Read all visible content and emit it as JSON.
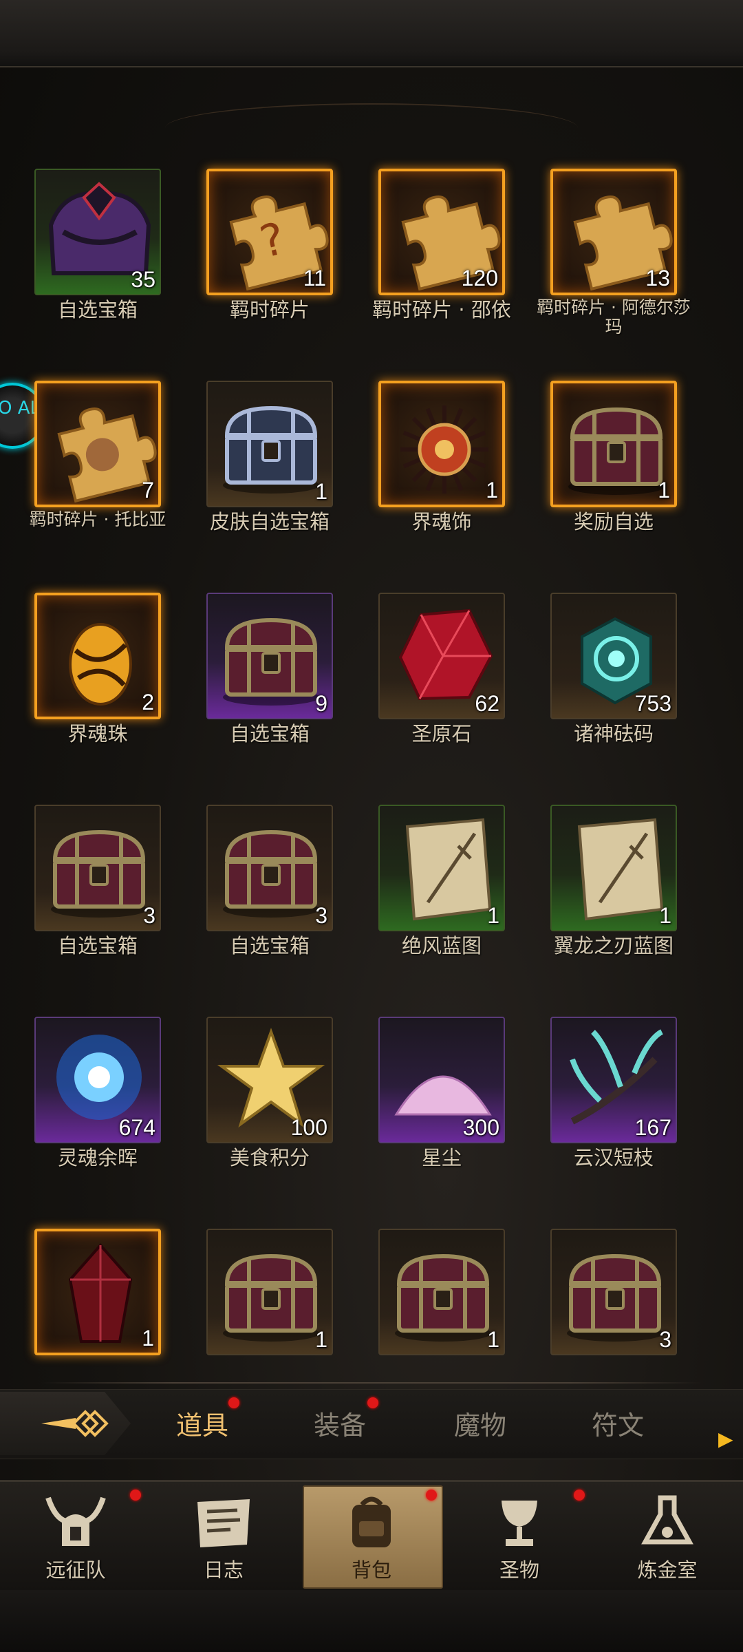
{
  "items": [
    {
      "name": "自选宝箱",
      "count": "35",
      "rarity": "green",
      "icon": "purple-chest-icon"
    },
    {
      "name": "羁时碎片",
      "count": "11",
      "rarity": "gold",
      "icon": "puzzle-question-icon"
    },
    {
      "name": "羁时碎片 · 邵依",
      "count": "120",
      "rarity": "gold",
      "icon": "puzzle-piece-icon"
    },
    {
      "name": "羁时碎片 · 阿德尔莎玛",
      "count": "13",
      "rarity": "gold",
      "icon": "puzzle-piece-icon"
    },
    {
      "name": "羁时碎片 · 托比亚",
      "count": "7",
      "rarity": "gold",
      "icon": "puzzle-portrait-icon"
    },
    {
      "name": "皮肤自选宝箱",
      "count": "1",
      "rarity": "brown",
      "icon": "steel-chest-icon"
    },
    {
      "name": "界魂饰",
      "count": "1",
      "rarity": "gold",
      "icon": "sun-amulet-icon"
    },
    {
      "name": "奖励自选",
      "count": "1",
      "rarity": "gold",
      "icon": "treasure-chest-icon"
    },
    {
      "name": "界魂珠",
      "count": "2",
      "rarity": "gold",
      "icon": "golden-egg-icon"
    },
    {
      "name": "自选宝箱",
      "count": "9",
      "rarity": "purple",
      "icon": "treasure-chest-icon"
    },
    {
      "name": "圣原石",
      "count": "62",
      "rarity": "brown",
      "icon": "red-crystal-icon"
    },
    {
      "name": "诸神砝码",
      "count": "753",
      "rarity": "brown",
      "icon": "jade-cube-icon"
    },
    {
      "name": "自选宝箱",
      "count": "3",
      "rarity": "brown",
      "icon": "treasure-chest-icon"
    },
    {
      "name": "自选宝箱",
      "count": "3",
      "rarity": "brown",
      "icon": "treasure-chest-icon"
    },
    {
      "name": "绝风蓝图",
      "count": "1",
      "rarity": "green",
      "icon": "blueprint-scroll-icon"
    },
    {
      "name": "翼龙之刃蓝图",
      "count": "1",
      "rarity": "green",
      "icon": "blueprint-scroll-icon"
    },
    {
      "name": "灵魂余晖",
      "count": "674",
      "rarity": "purple",
      "icon": "blue-energy-orb-icon"
    },
    {
      "name": "美食积分",
      "count": "100",
      "rarity": "brown",
      "icon": "gold-star-icon"
    },
    {
      "name": "星尘",
      "count": "300",
      "rarity": "purple",
      "icon": "stardust-pile-icon"
    },
    {
      "name": "云汉短枝",
      "count": "167",
      "rarity": "purple",
      "icon": "crystal-branch-icon"
    },
    {
      "name": "",
      "count": "1",
      "rarity": "gold",
      "icon": "dark-red-crystal-icon"
    },
    {
      "name": "",
      "count": "1",
      "rarity": "brown",
      "icon": "treasure-chest-icon"
    },
    {
      "name": "",
      "count": "1",
      "rarity": "brown",
      "icon": "treasure-chest-icon"
    },
    {
      "name": "",
      "count": "3",
      "rarity": "brown",
      "icon": "treasure-chest-icon"
    }
  ],
  "tabs": [
    {
      "label": "道具",
      "active": true,
      "badge": true
    },
    {
      "label": "装备",
      "active": false,
      "badge": true
    },
    {
      "label": "魔物",
      "active": false,
      "badge": false
    },
    {
      "label": "符文",
      "active": false,
      "badge": false
    }
  ],
  "nav": [
    {
      "label": "远征队",
      "icon": "horned-helmet-icon",
      "badge": true,
      "active": false
    },
    {
      "label": "日志",
      "icon": "scroll-log-icon",
      "badge": false,
      "active": false
    },
    {
      "label": "背包",
      "icon": "backpack-icon",
      "badge": true,
      "active": true
    },
    {
      "label": "圣物",
      "icon": "chalice-icon",
      "badge": true,
      "active": false
    },
    {
      "label": "炼金室",
      "icon": "alchemy-icon",
      "badge": false,
      "active": false
    }
  ],
  "side_badge_text": "UO AL",
  "colors": {
    "gold_border": "#f4a020",
    "active_tab": "#f0c070",
    "badge_red": "#e01818",
    "more_arrow": "#f5b820"
  }
}
